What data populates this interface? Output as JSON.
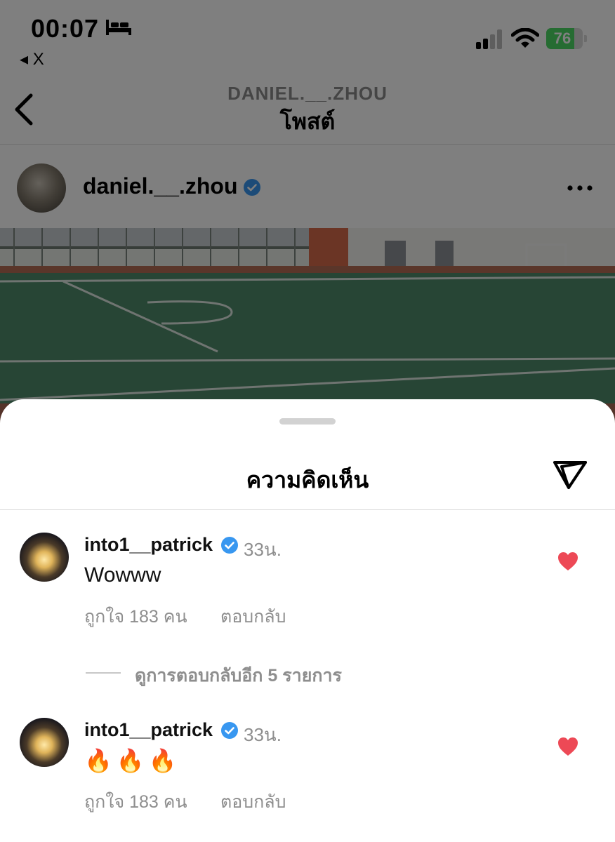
{
  "status_bar": {
    "time": "00:07",
    "back_app_label": "◂ X",
    "battery_percent": "76"
  },
  "nav": {
    "subtitle": "DANIEL.__.ZHOU",
    "title": "โพสต์"
  },
  "post": {
    "username": "daniel.__.zhou",
    "verified": true
  },
  "sheet": {
    "title": "ความคิดเห็น"
  },
  "comments": [
    {
      "username": "into1__patrick",
      "time": "33น.",
      "text": "Wowww",
      "likes_label": "ถูกใจ 183 คน",
      "reply_label": "ตอบกลับ",
      "liked": true
    },
    {
      "username": "into1__patrick",
      "time": "33น.",
      "text": "🔥🔥🔥",
      "likes_label": "ถูกใจ 183 คน",
      "reply_label": "ตอบกลับ",
      "liked": true
    }
  ],
  "view_replies": {
    "label": "ดูการตอบกลับอีก 5 รายการ"
  },
  "colors": {
    "verified_blue": "#3897f0",
    "heart_red": "#ed4956",
    "battery_green": "#4cd964"
  },
  "icons": [
    "bed-icon",
    "signal-icon",
    "wifi-icon",
    "battery-icon",
    "back-chevron-icon",
    "verified-badge-icon",
    "more-icon",
    "send-icon",
    "heart-icon"
  ]
}
